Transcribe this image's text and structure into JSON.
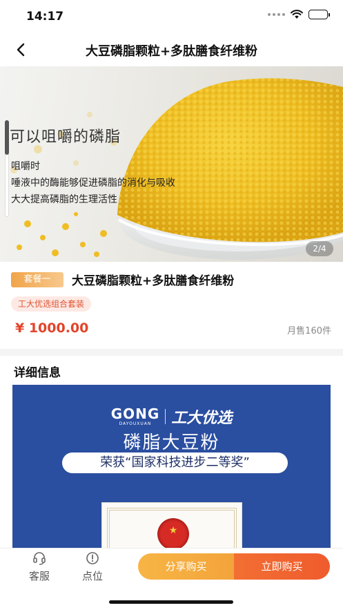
{
  "status_bar": {
    "time": "14:17"
  },
  "nav": {
    "title": "大豆磷脂颗粒+多肽膳食纤维粉"
  },
  "banner": {
    "headline": "可以咀嚼的磷脂",
    "lines": [
      "咀嚼时",
      "唾液中的酶能够促进磷脂的消化与吸收",
      "大大提高磷脂的生理活性"
    ],
    "pager": "2/4"
  },
  "product": {
    "package_tag": "套餐一",
    "title": "大豆磷脂颗粒+多肽膳食纤维粉",
    "combo_badge": "工大优选组合套装",
    "price": "¥ 1000.00",
    "sold": "月售160件"
  },
  "detail": {
    "section_title": "详细信息",
    "brand_en": "GONG",
    "brand_en_sub": "DAYOUXUAN",
    "brand_cn": "工大优选",
    "poster_title": "磷脂大豆粉",
    "award": "荣获“国家科技进步二等奖”"
  },
  "bottom_bar": {
    "service_label": "客服",
    "location_label": "点位",
    "share_buy_label": "分享购买",
    "buy_now_label": "立即购买"
  },
  "colors": {
    "price": "#e2442a",
    "buy_now": "#ef5b2d",
    "share_buy": "#f3a43c",
    "poster_bg": "#2a4ea0"
  },
  "icons": [
    "wifi-icon",
    "battery-icon",
    "back-arrow-icon",
    "headset-icon",
    "alert-circle-icon"
  ]
}
